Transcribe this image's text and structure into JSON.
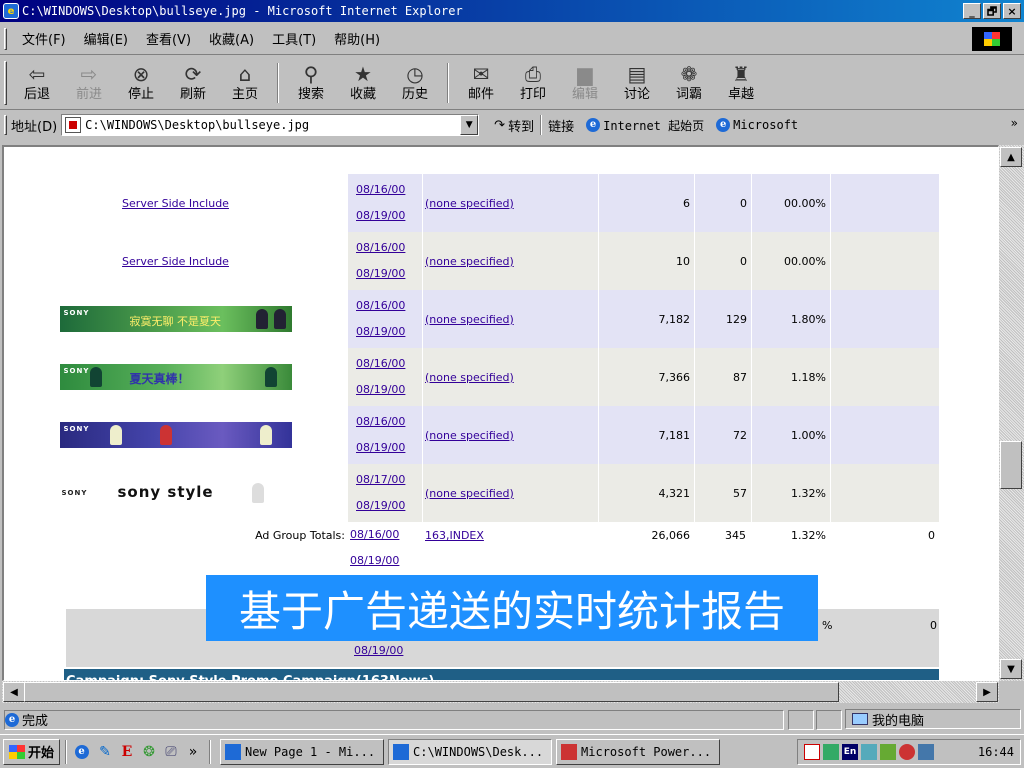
{
  "window": {
    "title": "C:\\WINDOWS\\Desktop\\bullseye.jpg - Microsoft Internet Explorer",
    "buttons": [
      "_",
      "🗗",
      "×"
    ]
  },
  "menu": [
    "文件(F)",
    "编辑(E)",
    "查看(V)",
    "收藏(A)",
    "工具(T)",
    "帮助(H)"
  ],
  "toolbar": [
    {
      "icon": "back-arrow-icon",
      "glyph": "⇦",
      "label": "后退",
      "disabled": false
    },
    {
      "icon": "forward-arrow-icon",
      "glyph": "⇨",
      "label": "前进",
      "disabled": true
    },
    {
      "icon": "stop-icon",
      "glyph": "⊗",
      "label": "停止",
      "disabled": false
    },
    {
      "icon": "refresh-icon",
      "glyph": "⟳",
      "label": "刷新",
      "disabled": false
    },
    {
      "icon": "home-icon",
      "glyph": "⌂",
      "label": "主页",
      "disabled": false
    },
    {
      "icon": "search-icon",
      "glyph": "⚲",
      "label": "搜索",
      "disabled": false
    },
    {
      "icon": "favorites-icon",
      "glyph": "★",
      "label": "收藏",
      "disabled": false
    },
    {
      "icon": "history-icon",
      "glyph": "◷",
      "label": "历史",
      "disabled": false
    },
    {
      "icon": "mail-icon",
      "glyph": "✉",
      "label": "邮件",
      "disabled": false
    },
    {
      "icon": "print-icon",
      "glyph": "⎙",
      "label": "打印",
      "disabled": false
    },
    {
      "icon": "edit-icon",
      "glyph": "▆",
      "label": "编辑",
      "disabled": true
    },
    {
      "icon": "discuss-icon",
      "glyph": "▤",
      "label": "讨论",
      "disabled": false
    },
    {
      "icon": "dictionary-icon",
      "glyph": "❁",
      "label": "词霸",
      "disabled": false
    },
    {
      "icon": "zhuoyue-icon",
      "glyph": "♜",
      "label": "卓越",
      "disabled": false
    }
  ],
  "address": {
    "label": "地址(D)",
    "value": "C:\\WINDOWS\\Desktop\\bullseye.jpg",
    "go": "转到",
    "links_label": "链接",
    "links": [
      "Internet 起始页",
      "Microsoft"
    ],
    "more": "»"
  },
  "report": {
    "rows": [
      {
        "type": "link",
        "name": "Server Side Include",
        "start": "08/16/00",
        "end": "08/19/00",
        "target": "(none specified)",
        "impressions": "6",
        "clicks": "0",
        "ctr": "00.00%",
        "extra": "",
        "band": "blue"
      },
      {
        "type": "link",
        "name": "Server Side Include",
        "start": "08/16/00",
        "end": "08/19/00",
        "target": "(none specified)",
        "impressions": "10",
        "clicks": "0",
        "ctr": "00.00%",
        "extra": "",
        "band": "gray"
      },
      {
        "type": "banner",
        "banner": "b1",
        "brand": "SONY",
        "btext": "寂寞无聊  不是夏天",
        "start": "08/16/00",
        "end": "08/19/00",
        "target": "(none specified)",
        "impressions": "7,182",
        "clicks": "129",
        "ctr": "1.80%",
        "extra": "",
        "band": "blue"
      },
      {
        "type": "banner",
        "banner": "b2",
        "brand": "SONY",
        "btext": "夏天真棒！",
        "start": "08/16/00",
        "end": "08/19/00",
        "target": "(none specified)",
        "impressions": "7,366",
        "clicks": "87",
        "ctr": "1.18%",
        "extra": "",
        "band": "gray"
      },
      {
        "type": "banner",
        "banner": "b3",
        "brand": "SONY",
        "btext": "",
        "start": "08/16/00",
        "end": "08/19/00",
        "target": "(none specified)",
        "impressions": "7,181",
        "clicks": "72",
        "ctr": "1.00%",
        "extra": "",
        "band": "blue"
      },
      {
        "type": "banner",
        "banner": "b4",
        "brand": "SONY",
        "btext": "sony style",
        "start": "08/17/00",
        "end": "08/19/00",
        "target": "(none specified)",
        "impressions": "4,321",
        "clicks": "57",
        "ctr": "1.32%",
        "extra": "",
        "band": "gray"
      }
    ],
    "totals": {
      "label": "Ad Group Totals:",
      "start": "08/16/00",
      "end": "08/19/00",
      "target": "163,INDEX",
      "impressions": "26,066",
      "clicks": "345",
      "ctr": "1.32%",
      "extra": "0"
    },
    "partial_row": {
      "end": "08/19/00",
      "ctr_fragment": "%",
      "extra": "0"
    },
    "campaign_header": "Campaign: Sony Style Promo Campaign(163News)"
  },
  "overlay_caption": "基于广告递送的实时统计报告",
  "status": {
    "text": "完成",
    "zone": "我的电脑"
  },
  "taskbar": {
    "start": "开始",
    "quicklaunch": [
      "ie-icon",
      "outlook-icon",
      "e-icon",
      "channel-icon",
      "desktop-icon"
    ],
    "chevron": "»",
    "tasks": [
      {
        "label": "New Page 1 - Mi...",
        "active": false,
        "icon": "ie-page-icon"
      },
      {
        "label": "C:\\WINDOWS\\Desk...",
        "active": true,
        "icon": "ie-page-icon"
      },
      {
        "label": "Microsoft Power...",
        "active": false,
        "icon": "powerpoint-icon"
      }
    ],
    "clock": "16:44"
  }
}
